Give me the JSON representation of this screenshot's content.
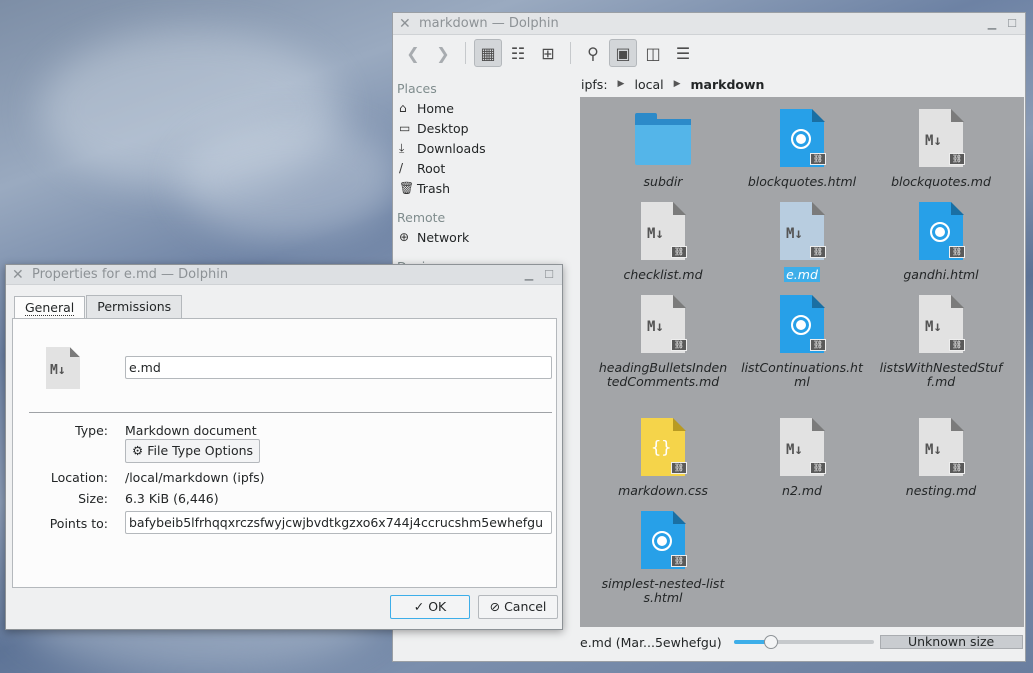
{
  "dolphin": {
    "title": "markdown — Dolphin",
    "places": {
      "section_places": "Places",
      "items": [
        {
          "label": "Home",
          "icon": "home-icon"
        },
        {
          "label": "Desktop",
          "icon": "desktop-icon"
        },
        {
          "label": "Downloads",
          "icon": "downloads-icon"
        },
        {
          "label": "Root",
          "icon": "root-icon"
        },
        {
          "label": "Trash",
          "icon": "trash-icon"
        }
      ],
      "section_remote": "Remote",
      "network": "Network",
      "section_devices": "Devices"
    },
    "breadcrumb": [
      "ipfs:",
      "local",
      "markdown"
    ],
    "files": [
      {
        "name": "subdir",
        "type": "folder"
      },
      {
        "name": "blockquotes.html",
        "type": "html"
      },
      {
        "name": "blockquotes.md",
        "type": "md"
      },
      {
        "name": "checklist.md",
        "type": "md"
      },
      {
        "name": "e.md",
        "type": "md",
        "selected": true
      },
      {
        "name": "gandhi.html",
        "type": "html"
      },
      {
        "name": "headingBulletsIndentedComments.md",
        "type": "md"
      },
      {
        "name": "listContinuations.html",
        "type": "html"
      },
      {
        "name": "listsWithNestedStuff.md",
        "type": "md"
      },
      {
        "name": "markdown.css",
        "type": "css"
      },
      {
        "name": "n2.md",
        "type": "md"
      },
      {
        "name": "nesting.md",
        "type": "md"
      },
      {
        "name": "simplest-nested-lists.html",
        "type": "html"
      }
    ],
    "statusbar": {
      "text": "e.md (Mar...5ewhefgu)",
      "zoom_fraction": 0.27,
      "size_text": "Unknown size"
    }
  },
  "dialog": {
    "title": "Properties for e.md — Dolphin",
    "tabs": {
      "general": "General",
      "permissions": "Permissions"
    },
    "name_value": "e.md",
    "type_label": "Type:",
    "type_value": "Markdown document",
    "file_type_button": "File Type Options",
    "location_label": "Location:",
    "location_value": "/local/markdown (ipfs)",
    "size_label": "Size:",
    "size_value": "6.3 KiB (6,446)",
    "points_label": "Points to:",
    "points_value": "bafybeib5lfrhqqxrczsfwyjcwjbvdtkgzxo6x744j4ccrucshm5ewhefgu",
    "ok_label": "OK",
    "cancel_label": "Cancel"
  },
  "colors": {
    "selection": "#3daee9",
    "html_icon": "#27a0e8",
    "css_icon": "#f5d44a",
    "folder_icon": "#54b5e9",
    "view_background": "#a3a5a8"
  }
}
